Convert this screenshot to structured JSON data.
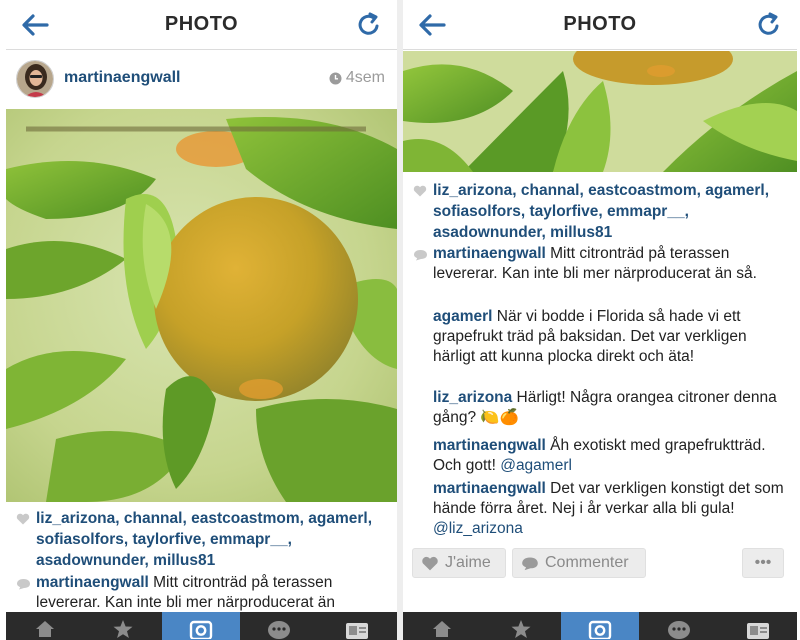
{
  "left_screen": {
    "nav": {
      "title": "PHOTO"
    },
    "post": {
      "username": "martinaengwall",
      "timestamp": "4sem"
    },
    "likes": [
      "liz_arizona",
      "channal",
      "eastcoastmom",
      "agamerl",
      "sofiasolfors",
      "taylorfive",
      "emmapr__",
      "asadownunder",
      "millus81"
    ],
    "comments": [
      {
        "user": "martinaengwall",
        "text": " Mitt citronträd på terassen levererar. Kan inte bli mer närproducerat än"
      }
    ],
    "tabbar": {
      "tabs": [
        "home-icon",
        "explore-star-icon",
        "camera-icon",
        "activity-bubble-icon",
        "profile-icon"
      ],
      "active_index": 2
    }
  },
  "right_screen": {
    "nav": {
      "title": "PHOTO"
    },
    "likes": [
      "liz_arizona",
      "channal",
      "eastcoastmom",
      "agamerl",
      "sofiasolfors",
      "taylorfive",
      "emmapr__",
      "asadownunder",
      "millus81"
    ],
    "comments": [
      {
        "user": "martinaengwall",
        "text": " Mitt citronträd på terassen levererar. Kan inte bli mer närproducerat än så."
      },
      {
        "user": "agamerl",
        "text": " När vi bodde i Florida så hade vi ett grapefrukt träd på baksidan. Det var verkligen härligt att kunna plocka direkt och äta!"
      },
      {
        "user": "liz_arizona",
        "text": " Härligt! Några orangea citroner denna gång? 🍋🍊"
      },
      {
        "user": "martinaengwall",
        "text": " Åh exotiskt med grapefruktträd. Och gott! ",
        "mention": "@agamerl"
      },
      {
        "user": "martinaengwall",
        "text": " Det var verkligen konstigt det som hände förra året. Nej i år verkar alla bli gula! ",
        "mention": "@liz_arizona"
      }
    ],
    "actions": {
      "like_label": "J'aime",
      "comment_label": "Commenter",
      "more_label": "•••"
    },
    "tabbar": {
      "tabs": [
        "home-icon",
        "explore-star-icon",
        "camera-icon",
        "activity-bubble-icon",
        "profile-icon"
      ],
      "active_index": 2
    }
  },
  "colors": {
    "link": "#1f4e79",
    "tab_active": "#4a86c5",
    "tabbar_bg": "#2b2b2b",
    "nav_icon": "#2f6aa8"
  }
}
